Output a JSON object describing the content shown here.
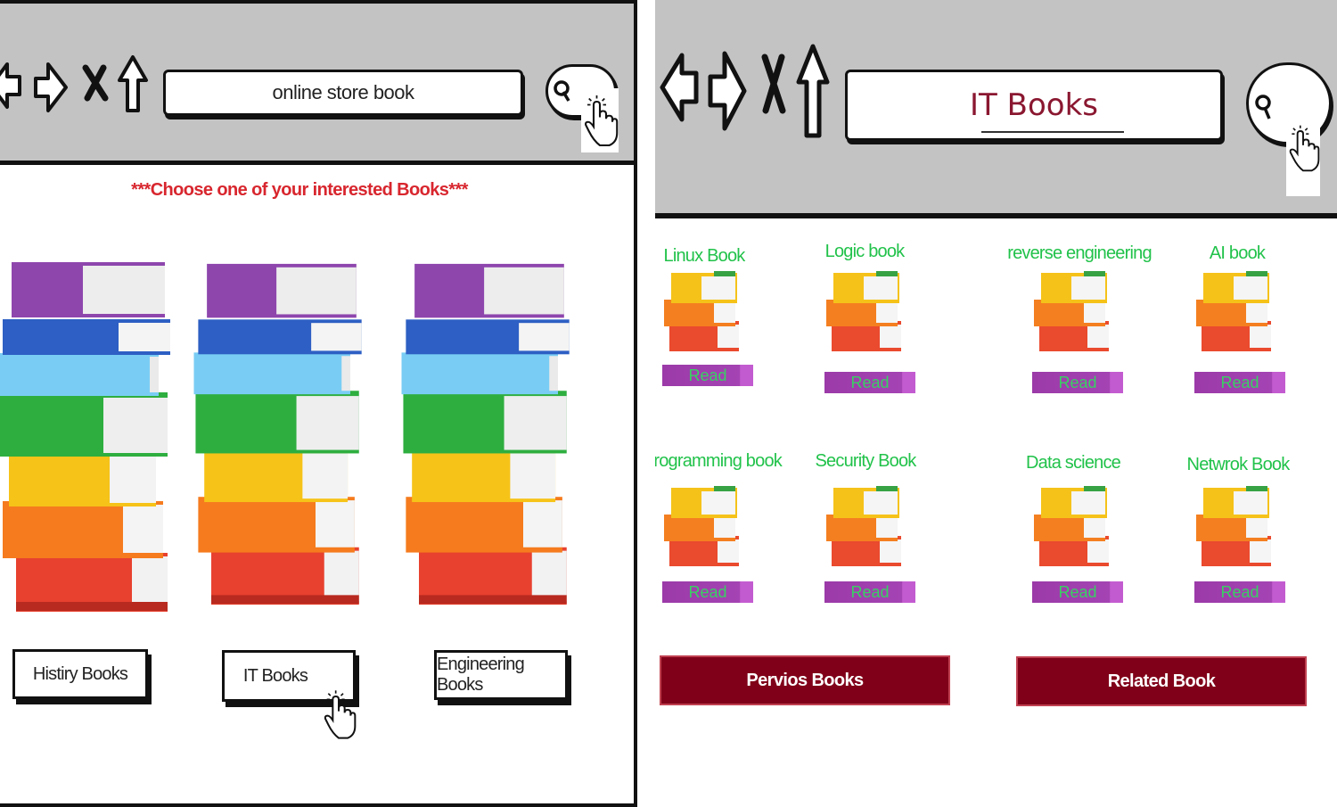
{
  "left_screen": {
    "toolbar": {
      "address_value": "online store book",
      "icons": [
        "back-arrow-icon",
        "forward-arrow-icon",
        "close-x-icon",
        "home-up-arrow-icon",
        "search-magnifier-icon",
        "hand-cursor-icon"
      ]
    },
    "heading": "***Choose one of your interested Books***",
    "categories": [
      {
        "label": "Histiry Books"
      },
      {
        "label": "IT Books"
      },
      {
        "label": "Engineering Books"
      }
    ]
  },
  "right_screen": {
    "toolbar": {
      "address_value": "IT Books"
    },
    "books": [
      {
        "title": "Linux Book",
        "action": "Read"
      },
      {
        "title": "Logic book",
        "action": "Read"
      },
      {
        "title": "reverse engineering",
        "action": "Read"
      },
      {
        "title": "AI book",
        "action": "Read"
      },
      {
        "title": "programming book",
        "action": "Read"
      },
      {
        "title": "Security Book",
        "action": "Read"
      },
      {
        "title": "Data science",
        "action": "Read"
      },
      {
        "title": "Netwrok Book",
        "action": "Read"
      }
    ],
    "previous_button": "Pervios Books",
    "related_button": "Related Book"
  },
  "colors": {
    "toolbar_gray": "#c3c3c3",
    "heading_red": "#d8262e",
    "address_title_maroon": "#8a1730",
    "book_title_green": "#21c24a",
    "read_button_purple": "#9b3aa8",
    "bottom_button_maroon": "#800019"
  }
}
